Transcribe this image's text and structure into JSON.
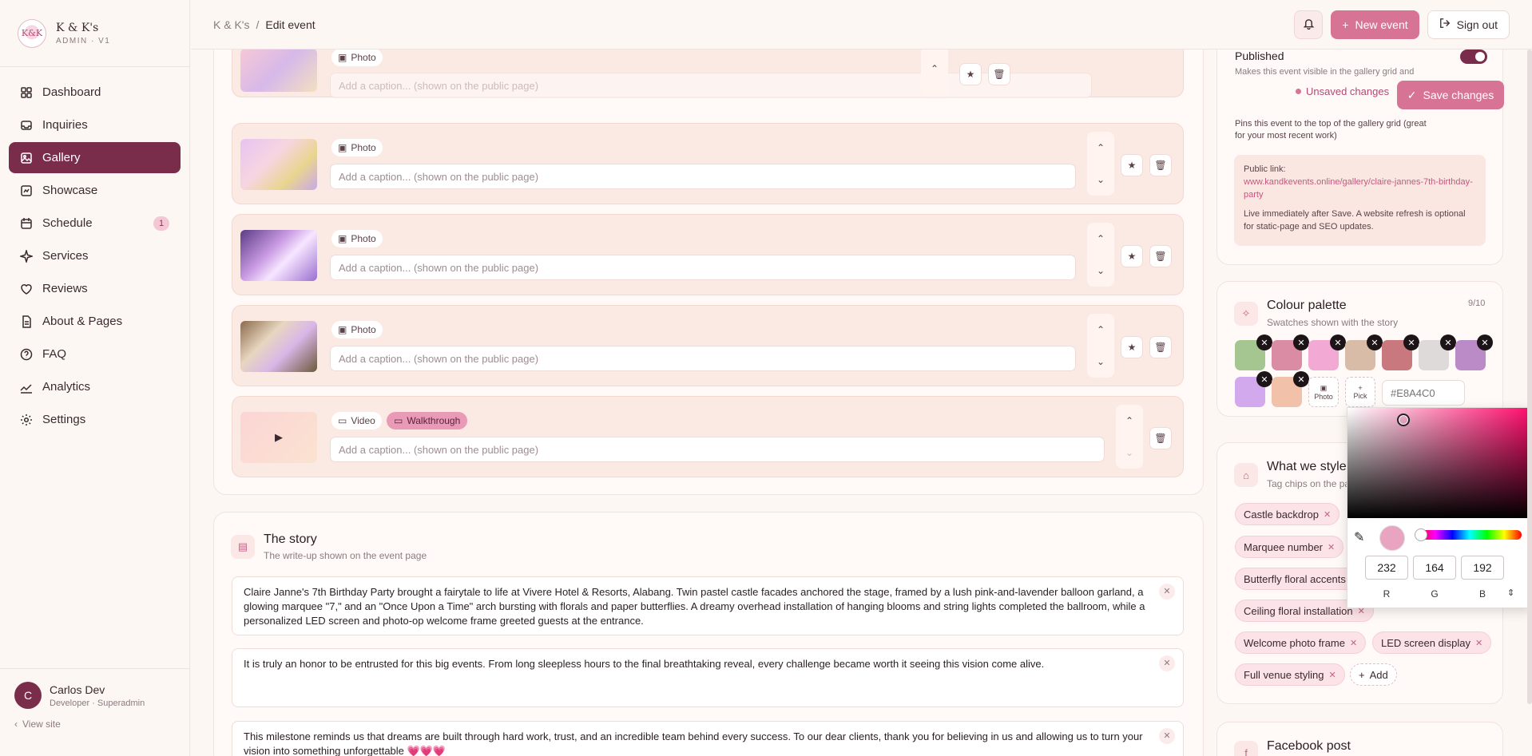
{
  "brand": {
    "name": "K & K's",
    "sub": "ADMIN · V1",
    "logo_text": "K&K"
  },
  "nav": [
    {
      "label": "Dashboard",
      "icon": "grid-icon"
    },
    {
      "label": "Inquiries",
      "icon": "inbox-icon"
    },
    {
      "label": "Gallery",
      "icon": "image-icon",
      "active": true
    },
    {
      "label": "Showcase",
      "icon": "showcase-icon"
    },
    {
      "label": "Schedule",
      "icon": "calendar-icon",
      "badge": "1"
    },
    {
      "label": "Services",
      "icon": "sparkle-icon"
    },
    {
      "label": "Reviews",
      "icon": "heart-icon"
    },
    {
      "label": "About & Pages",
      "icon": "file-icon"
    },
    {
      "label": "FAQ",
      "icon": "help-icon"
    },
    {
      "label": "Analytics",
      "icon": "chart-icon"
    },
    {
      "label": "Settings",
      "icon": "gear-icon"
    }
  ],
  "user": {
    "initial": "C",
    "name": "Carlos Dev",
    "role": "Developer · Superadmin",
    "view_site": "View site"
  },
  "header": {
    "crumb_root": "K & K's",
    "crumb_sep": "/",
    "crumb_current": "Edit event",
    "new_event": "New event",
    "sign_out": "Sign out"
  },
  "savebar": {
    "unsaved": "Unsaved changes",
    "save": "Save changes"
  },
  "media": {
    "photo_label": "Photo",
    "video_label": "Video",
    "walkthrough_label": "Walkthrough",
    "caption_placeholder": "Add a caption... (shown on the public page)"
  },
  "story": {
    "title": "The story",
    "subtitle": "The write-up shown on the event page",
    "paragraphs": [
      "Claire Janne's 7th Birthday Party brought a fairytale to life at Vivere Hotel & Resorts, Alabang. Twin pastel castle facades anchored the stage, framed by a lush pink-and-lavender balloon garland, a glowing marquee \"7,\" and an \"Once Upon a Time\" arch bursting with florals and paper butterflies. A dreamy overhead installation of hanging blooms and string lights completed the ballroom, while a personalized LED screen and photo-op welcome frame greeted guests at the entrance.",
      "It is truly an honor to be entrusted for this big events. From long sleepless hours to the final breathtaking reveal, every challenge became worth it seeing this vision come alive.",
      "This milestone reminds us that dreams are built through hard work, trust, and an incredible team behind every success. To our dear clients, thank you for believing in us and allowing us to turn your vision into something unforgettable 💗💗💗"
    ]
  },
  "publish": {
    "published_label": "Published",
    "published_desc": "Makes this event visible in the gallery grid and",
    "featured_desc": "Pins this event to the top of the gallery grid (great for your most recent work)",
    "public_link_label": "Public link:",
    "public_link": "www.kandkevents.online/gallery/claire-jannes-7th-birthday-party",
    "live_note": "Live immediately after Save. A website refresh is optional for static-page and SEO updates."
  },
  "palette": {
    "title": "Colour palette",
    "subtitle": "Swatches shown with the story",
    "count": "9/10",
    "swatches": [
      "#A5C690",
      "#D98CA3",
      "#F2A9D3",
      "#D9BCA7",
      "#C9797E",
      "#DEDADA",
      "#BB8BC7",
      "#D3A9EE",
      "#F2C1A9"
    ],
    "photo_label": "Photo",
    "pick_label": "Pick",
    "hex_placeholder": "#E8A4C0"
  },
  "styled": {
    "title": "What we styled",
    "subtitle": "Tag chips on the page",
    "tags": [
      "Castle backdrop",
      "Marquee number",
      "Butterfly floral accents",
      "Ceiling floral installation",
      "Welcome photo frame",
      "LED screen display",
      "Full venue styling"
    ],
    "add_label": "Add"
  },
  "facebook": {
    "title": "Facebook post"
  },
  "picker": {
    "color": "#E8A4C0",
    "r": "232",
    "g": "164",
    "b": "192",
    "r_label": "R",
    "g_label": "G",
    "b_label": "B"
  }
}
